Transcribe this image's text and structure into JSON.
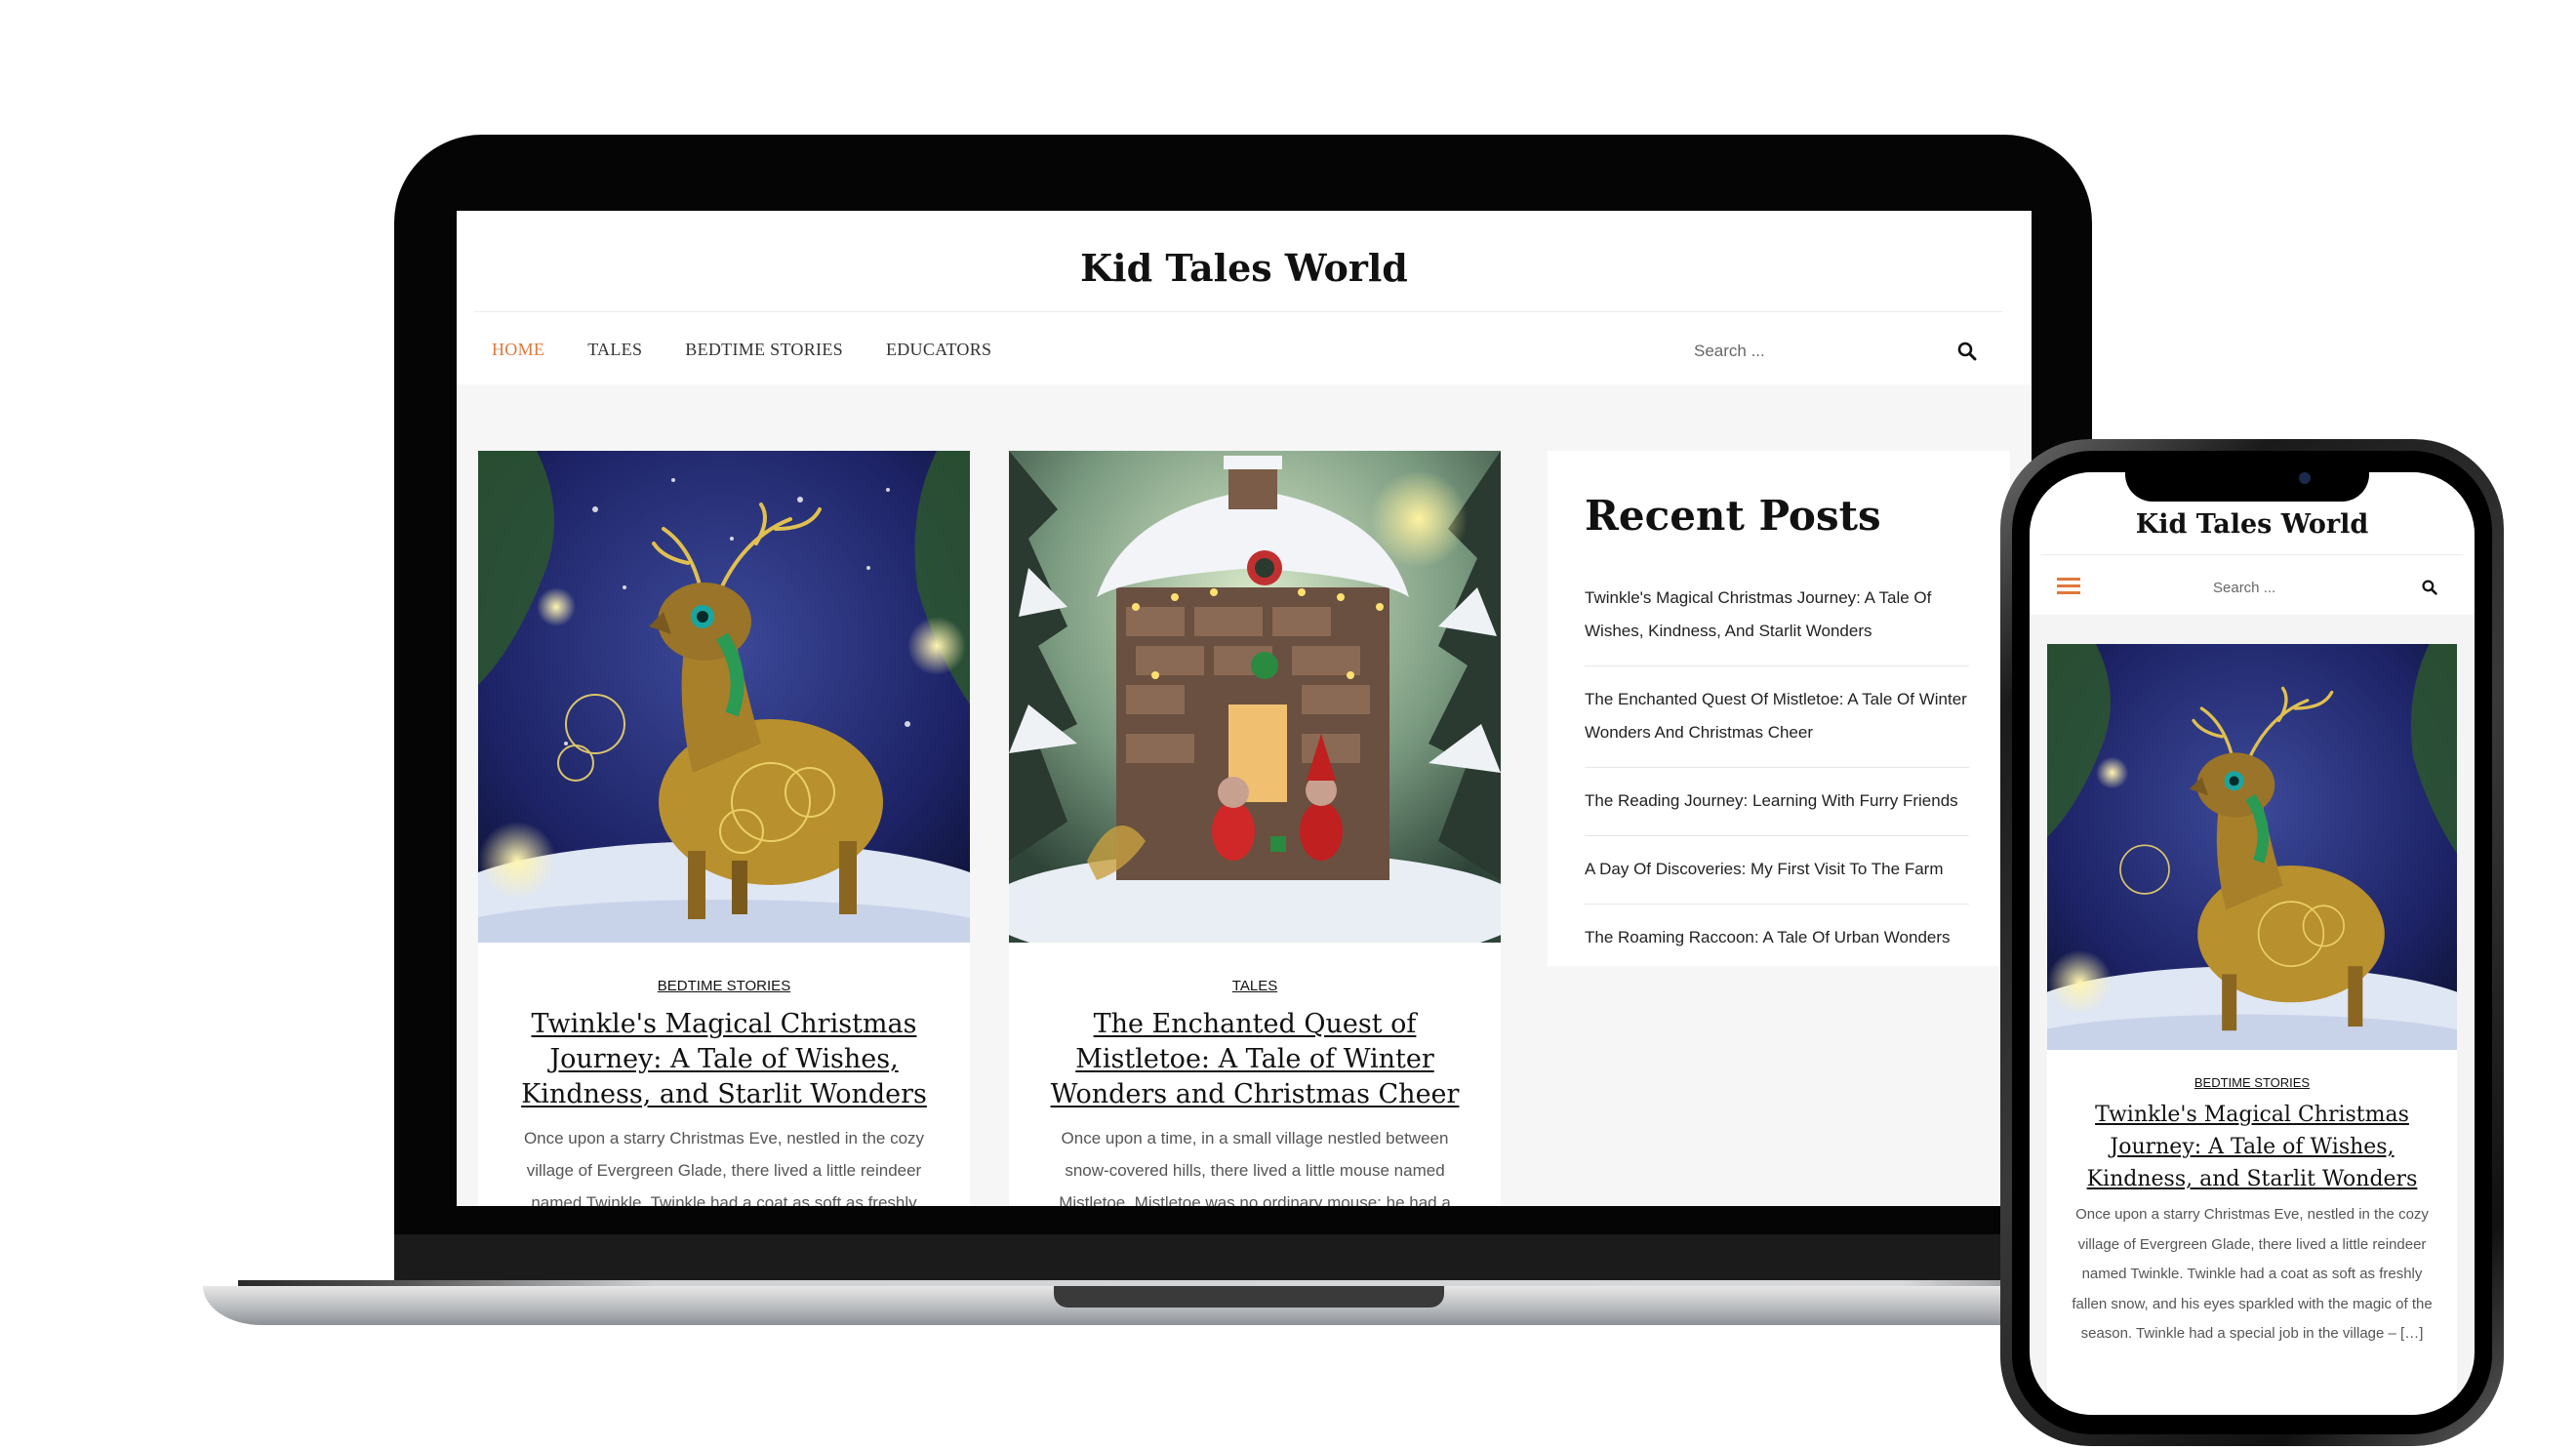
{
  "site": {
    "title": "Kid Tales World"
  },
  "nav": {
    "items": [
      "HOME",
      "TALES",
      "BEDTIME STORIES",
      "EDUCATORS"
    ],
    "active_index": 0
  },
  "search": {
    "placeholder": "Search ..."
  },
  "posts": [
    {
      "category": "BEDTIME STORIES",
      "title": "Twinkle's Magical Christmas Journey: A Tale of Wishes, Kindness, and Starlit Wonders",
      "excerpt": "Once upon a starry Christmas Eve, nestled in the cozy village of Evergreen Glade, there lived a little reindeer named Twinkle. Twinkle had a coat as soft as freshly"
    },
    {
      "category": "TALES",
      "title": "The Enchanted Quest of Mistletoe: A Tale of Winter Wonders and Christmas Cheer",
      "excerpt": "Once upon a time, in a small village nestled between snow-covered hills, there lived a little mouse named Mistletoe. Mistletoe was no ordinary mouse; he had a"
    }
  ],
  "sidebar": {
    "title": "Recent Posts",
    "items": [
      "Twinkle's Magical Christmas Journey: A Tale Of Wishes, Kindness, And Starlit Wonders",
      "The Enchanted Quest Of Mistletoe: A Tale Of Winter Wonders And Christmas Cheer",
      "The Reading Journey: Learning With Furry Friends",
      "A Day Of Discoveries: My First Visit To The Farm",
      "The Roaming Raccoon: A Tale Of Urban Wonders"
    ]
  },
  "phone": {
    "title": "Kid Tales World",
    "search_placeholder": "Search ...",
    "post": {
      "category": "BEDTIME STORIES",
      "title": "Twinkle's Magical Christmas Journey: A Tale of Wishes, Kindness, and Starlit Wonders",
      "excerpt": "Once upon a starry Christmas Eve, nestled in the cozy village of Evergreen Glade, there lived a little reindeer named Twinkle. Twinkle had a coat as soft as freshly fallen snow, and his eyes sparkled with the magic of the season. Twinkle had a special job in the village – […]"
    }
  },
  "colors": {
    "accent": "#e0783b",
    "text": "#111111",
    "muted": "#555555",
    "page_bg": "#f6f6f6"
  },
  "icons": [
    "search-icon",
    "hamburger-menu-icon"
  ]
}
